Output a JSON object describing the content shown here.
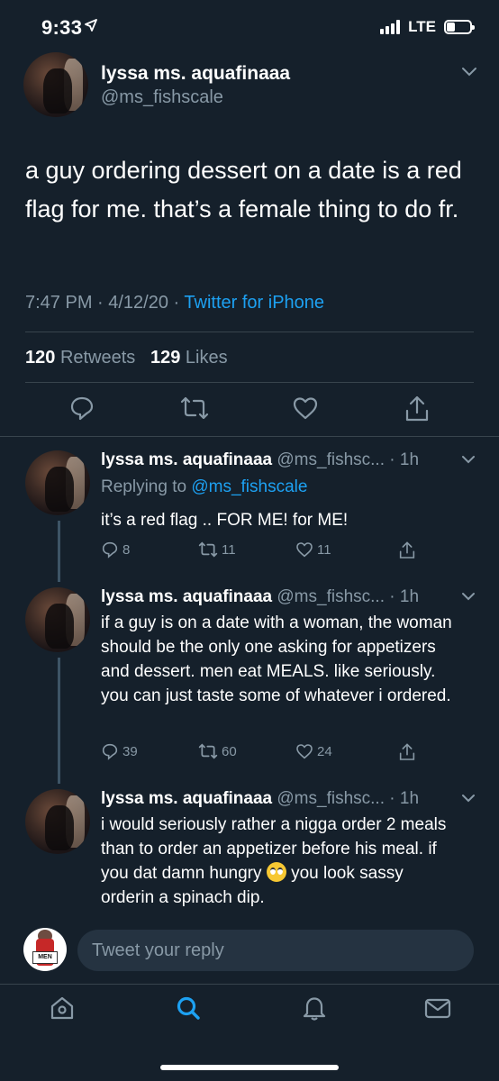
{
  "status": {
    "time": "9:33",
    "network": "LTE"
  },
  "main_tweet": {
    "name": "lyssa ms. aquafinaaa",
    "handle": "@ms_fishscale",
    "text": "a guy ordering dessert on a date is a red flag for me. that’s a female thing to do fr.",
    "time_date": "7:47 PM · 4/12/20 · ",
    "client": "Twitter for iPhone",
    "retweets": "120",
    "retweets_label": "Retweets",
    "likes": "129",
    "likes_label": "Likes"
  },
  "replies": [
    {
      "name": "lyssa ms. aquafinaaa",
      "handle": "@ms_fishsc...",
      "age": "· 1h",
      "replying_label": "Replying to",
      "replying_to": "@ms_fishscale",
      "text": "it’s a red flag .. FOR ME! for ME!",
      "reply_count": "8",
      "retweet_count": "11",
      "like_count": "11"
    },
    {
      "name": "lyssa ms. aquafinaaa",
      "handle": "@ms_fishsc...",
      "age": "· 1h",
      "text": "if a guy is on a date with a woman, the woman should be the only one asking for appetizers and dessert. men eat MEALS. like seriously. you can just taste some of whatever i ordered.",
      "reply_count": "39",
      "retweet_count": "60",
      "like_count": "24"
    },
    {
      "name": "lyssa ms. aquafinaaa",
      "handle": "@ms_fishsc...",
      "age": "· 1h",
      "text_before_emoji": "i would seriously rather a nigga order 2 meals than to order an appetizer before his meal. if you dat damn hungry ",
      "text_after_emoji": " you look sassy orderin a spinach dip."
    }
  ],
  "compose": {
    "placeholder": "Tweet your reply",
    "avatar_sign_text": "MEN"
  },
  "icons": {
    "reply": "reply-icon",
    "retweet": "retweet-icon",
    "like": "heart-icon",
    "share": "share-icon",
    "home": "home-icon",
    "search": "search-icon",
    "notifications": "bell-icon",
    "messages": "mail-icon"
  },
  "colors": {
    "background": "#15202b",
    "accent": "#1da1f2",
    "muted": "#8899a6",
    "divider": "#38444d"
  }
}
